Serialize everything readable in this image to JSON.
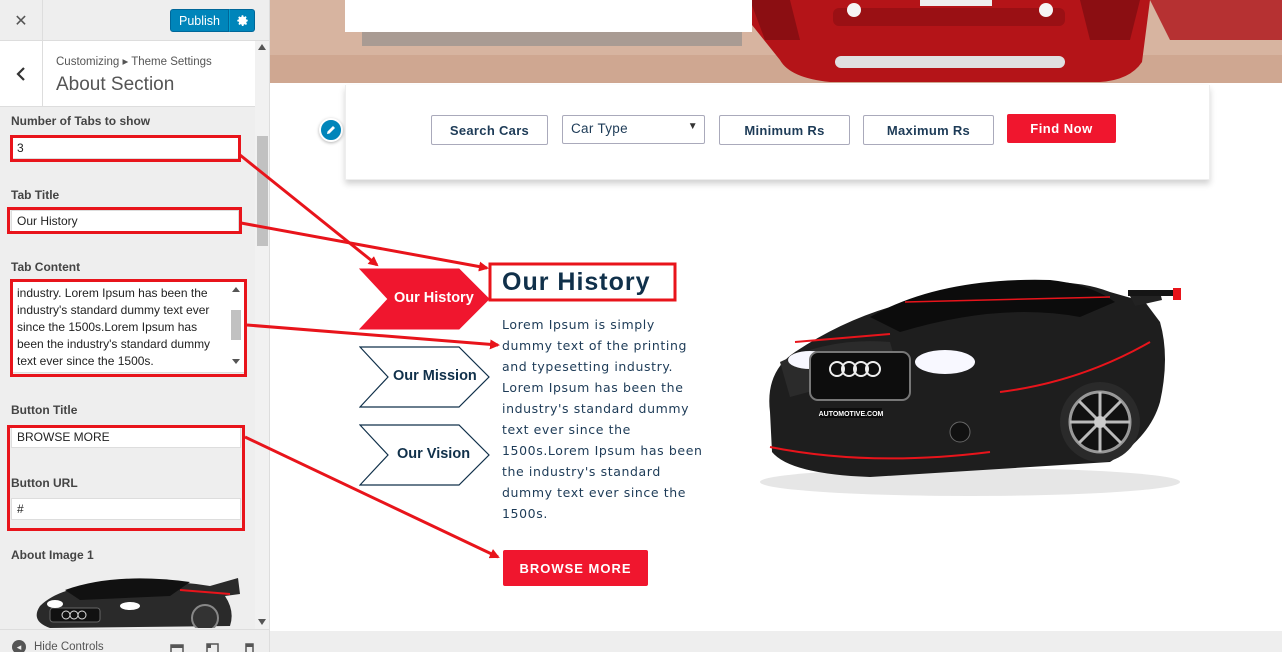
{
  "customizer": {
    "close_icon": "close-icon",
    "publish_label": "Publish",
    "breadcrumb": "Customizing ▸ Theme Settings",
    "section_title": "About Section",
    "fields": {
      "tabs_count_label": "Number of Tabs to show",
      "tabs_count_value": "3",
      "tab_title_label": "Tab Title",
      "tab_title_value": "Our History",
      "tab_content_label": "Tab Content",
      "tab_content_value": "industry. Lorem Ipsum has been the industry's standard dummy text ever since the 1500s.Lorem Ipsum has been the industry's standard dummy text ever since the 1500s.",
      "button_title_label": "Button Title",
      "button_title_value": "BROWSE MORE",
      "button_url_label": "Button URL",
      "button_url_value": "#",
      "about_image_label": "About Image 1"
    },
    "footer": {
      "hide_controls": "Hide Controls"
    }
  },
  "preview": {
    "search": {
      "search_cars": "Search Cars",
      "car_type": "Car Type",
      "minimum": "Minimum Rs",
      "maximum": "Maximum Rs",
      "find_now": "Find Now"
    },
    "tabs": [
      {
        "label": "Our History",
        "active": true
      },
      {
        "label": "Our Mission",
        "active": false
      },
      {
        "label": "Our Vision",
        "active": false
      }
    ],
    "about": {
      "title": "Our History",
      "lines": [
        "Lorem Ipsum is simply",
        "dummy text of the printing",
        "and typesetting industry.",
        "Lorem Ipsum has been the",
        "industry's standard dummy",
        "text ever since the",
        "1500s.Lorem Ipsum has been",
        "the industry's standard",
        "dummy text ever since the",
        "1500s."
      ],
      "button": "BROWSE MORE",
      "car_badge": "AUTOMOTIVE.COM"
    }
  },
  "colors": {
    "accent": "#f0162e",
    "wp_blue": "#0085ba",
    "navy": "#10304a",
    "annotation_red": "#e8141b"
  }
}
